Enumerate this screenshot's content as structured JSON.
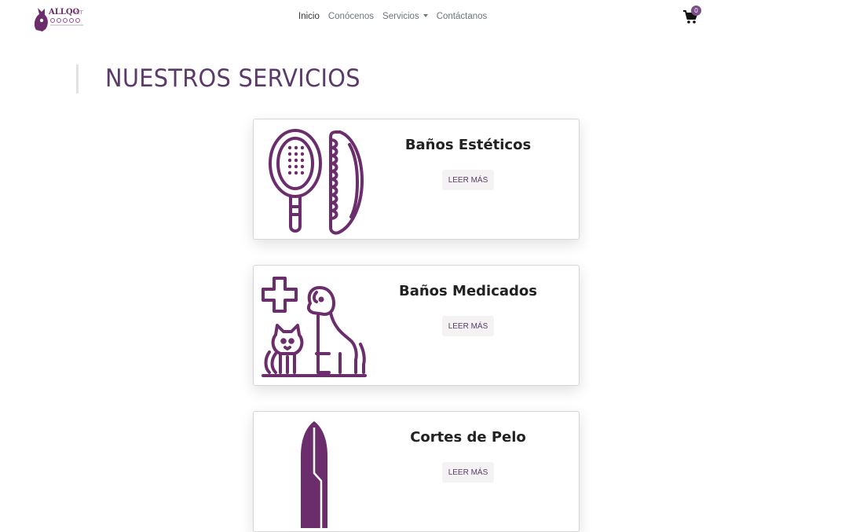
{
  "brand": {
    "logo_text": "ALLQO VET"
  },
  "nav": {
    "items": [
      {
        "label": "Inicio",
        "active": true
      },
      {
        "label": "Conócenos"
      },
      {
        "label": "Servicios",
        "dropdown": true
      },
      {
        "label": "Contáctanos"
      }
    ],
    "cart_count": "0"
  },
  "page": {
    "title": "NUESTROS SERVICIOS"
  },
  "services": [
    {
      "title": "Baños Estéticos",
      "button": "LEER MÁS",
      "icon": "brush-comb-icon"
    },
    {
      "title": "Baños Medicados",
      "button": "LEER MÁS",
      "icon": "pets-medical-icon"
    },
    {
      "title": "Cortes de Pelo",
      "button": "LEER MÁS",
      "icon": "clipper-icon"
    }
  ],
  "colors": {
    "accent": "#6b2d6b",
    "title": "#5b3a6b",
    "badge": "#7a4e86"
  }
}
